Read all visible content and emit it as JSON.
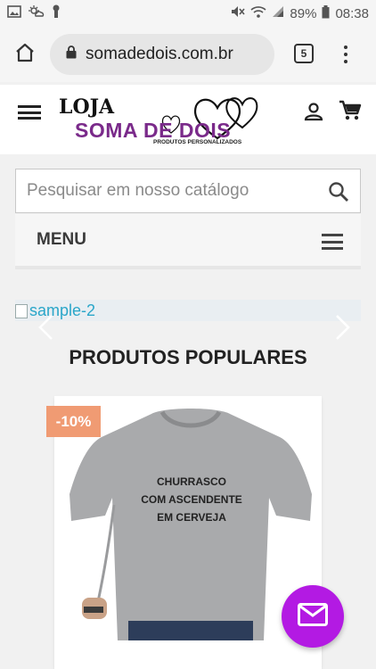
{
  "status_bar": {
    "battery": "89%",
    "time": "08:38"
  },
  "browser": {
    "url": "somadedois.com.br",
    "tab_count": "5"
  },
  "header": {
    "logo_line1": "LOJA",
    "logo_line2": "SOMA DE DOIS",
    "logo_tagline": "PRODUTOS PERSONALIZADOS"
  },
  "search": {
    "placeholder": "Pesquisar em nosso catálogo"
  },
  "menu": {
    "label": "MENU"
  },
  "carousel": {
    "image_alt": "sample-2"
  },
  "section": {
    "title": "PRODUTOS POPULARES"
  },
  "product": {
    "discount": "-10%",
    "shirt_line1": "CHURRASCO",
    "shirt_line2": "COM ASCENDENTE",
    "shirt_line3": "EM CERVEJA"
  },
  "colors": {
    "brand_purple": "#7a2a8a",
    "badge": "#f09b73",
    "fab": "#b31ae3"
  }
}
